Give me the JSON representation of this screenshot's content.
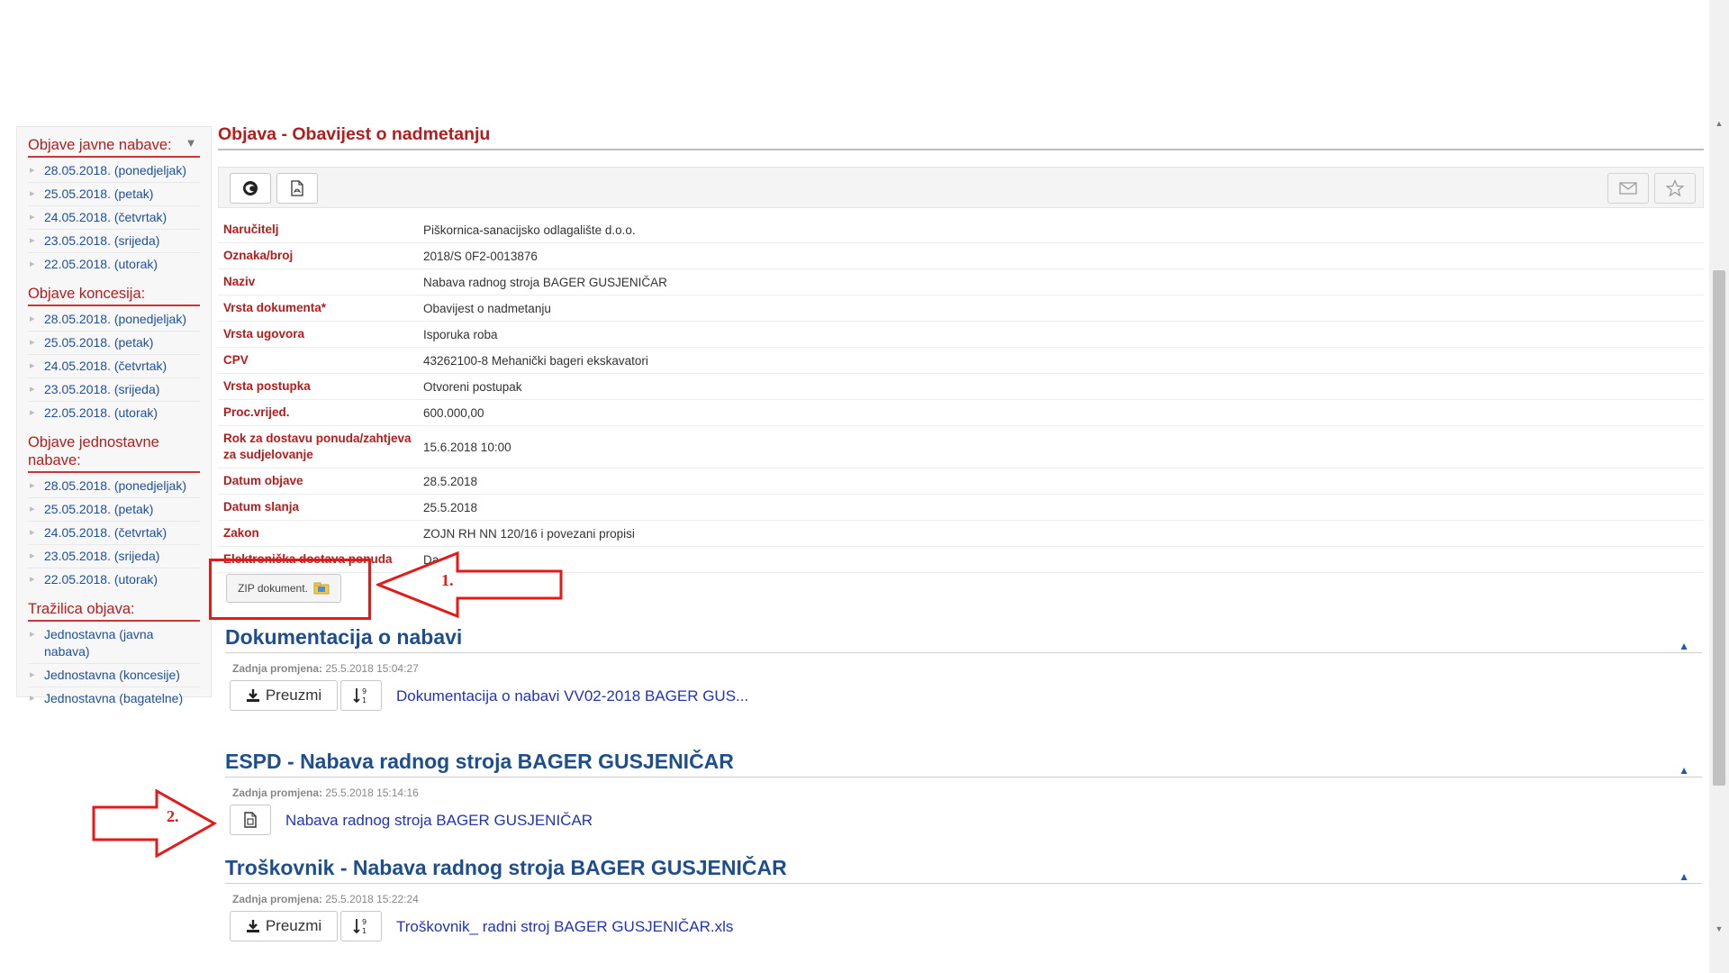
{
  "sidebar": {
    "sections": [
      {
        "title": "Objave javne nabave:",
        "items": [
          "28.05.2018. (ponedjeljak)",
          "25.05.2018. (petak)",
          "24.05.2018. (četvrtak)",
          "23.05.2018. (srijeda)",
          "22.05.2018. (utorak)"
        ]
      },
      {
        "title": "Objave koncesija:",
        "items": [
          "28.05.2018. (ponedjeljak)",
          "25.05.2018. (petak)",
          "24.05.2018. (četvrtak)",
          "23.05.2018. (srijeda)",
          "22.05.2018. (utorak)"
        ]
      },
      {
        "title": "Objave jednostavne nabave:",
        "items": [
          "28.05.2018. (ponedjeljak)",
          "25.05.2018. (petak)",
          "24.05.2018. (četvrtak)",
          "23.05.2018. (srijeda)",
          "22.05.2018. (utorak)"
        ]
      },
      {
        "title": "Tražilica objava:",
        "items": [
          "Jednostavna (javna nabava)",
          "Jednostavna (koncesije)",
          "Jednostavna (bagatelne)"
        ]
      }
    ]
  },
  "main": {
    "title": "Objava - Obavijest o nadmetanju",
    "details": [
      {
        "label": "Naručitelj",
        "value": "Piškornica-sanacijsko odlagalište d.o.o."
      },
      {
        "label": "Oznaka/broj",
        "value": "2018/S 0F2-0013876"
      },
      {
        "label": "Naziv",
        "value": "Nabava radnog stroja BAGER GUSJENIČAR"
      },
      {
        "label": "Vrsta dokumenta*",
        "value": "Obavijest o nadmetanju"
      },
      {
        "label": "Vrsta ugovora",
        "value": "Isporuka roba"
      },
      {
        "label": "CPV",
        "value": "43262100-8 Mehanički bageri ekskavatori"
      },
      {
        "label": "Vrsta postupka",
        "value": "Otvoreni postupak"
      },
      {
        "label": "Proc.vrijed.",
        "value": "600.000,00"
      },
      {
        "label": "Rok za dostavu ponuda/zahtjeva za sudjelovanje",
        "value": "15.6.2018 10:00"
      },
      {
        "label": "Datum objave",
        "value": "28.5.2018"
      },
      {
        "label": "Datum slanja",
        "value": "25.5.2018"
      },
      {
        "label": "Zakon",
        "value": "ZOJN RH NN 120/16 i povezani propisi"
      },
      {
        "label": "Elektronička dostava ponuda",
        "value": "Da"
      }
    ],
    "zip_label": "ZIP dokument.",
    "sections": [
      {
        "title": "Dokumentacija o nabavi",
        "meta_label": "Zadnja promjena:",
        "meta_value": "25.5.2018 15:04:27",
        "download_label": "Preuzmi",
        "link": "Dokumentacija o nabavi VV02-2018 BAGER GUS..."
      },
      {
        "title": "ESPD - Nabava radnog stroja BAGER GUSJENIČAR",
        "meta_label": "Zadnja promjena:",
        "meta_value": "25.5.2018 15:14:16",
        "link": "Nabava radnog stroja BAGER GUSJENIČAR"
      },
      {
        "title": "Troškovnik - Nabava radnog stroja BAGER GUSJENIČAR",
        "meta_label": "Zadnja promjena:",
        "meta_value": "25.5.2018 15:22:24",
        "download_label": "Preuzmi",
        "link": "Troškovnik_ radni stroj BAGER GUSJENIČAR.xls"
      }
    ]
  },
  "annotations": {
    "arrow1_label": "1.",
    "arrow2_label": "2."
  },
  "colors": {
    "accent_red": "#b41d1d",
    "link_blue": "#2233b8",
    "section_blue": "#1e4f8c",
    "annotation_red": "#e11a1a"
  }
}
